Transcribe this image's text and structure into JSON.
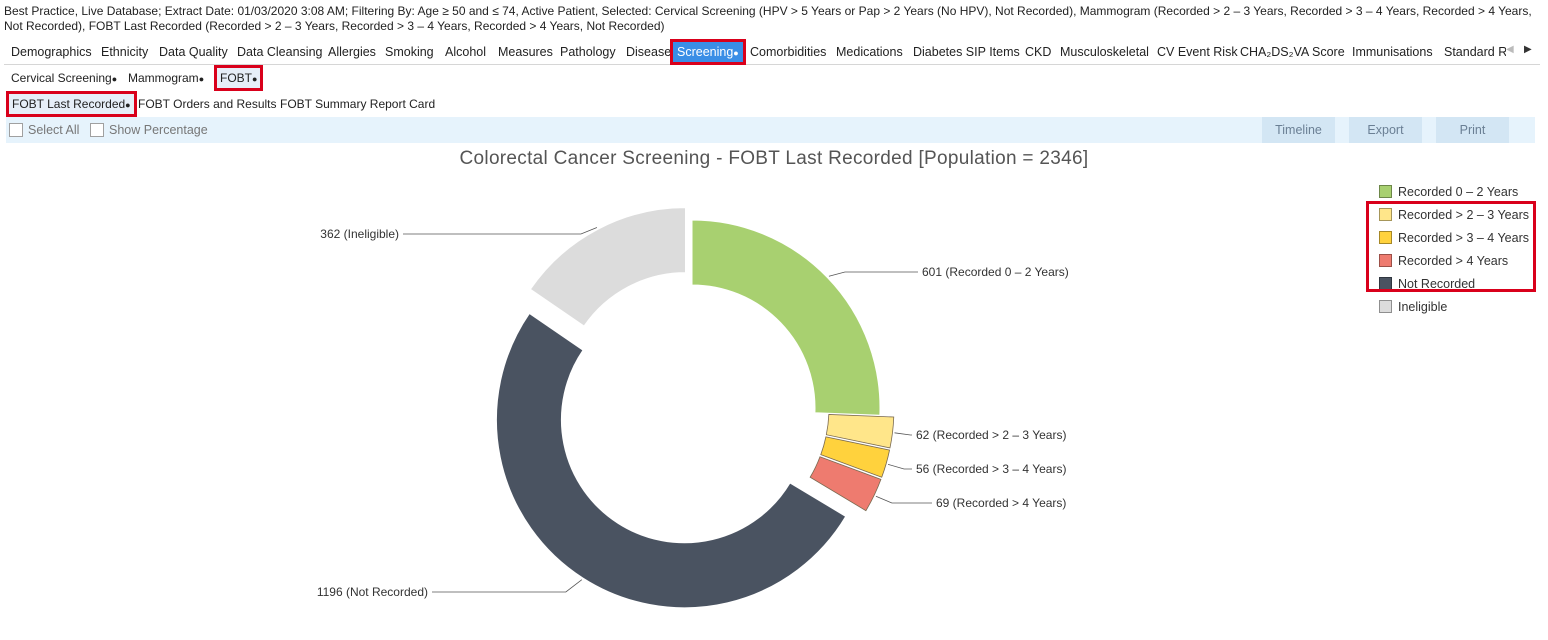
{
  "header": {
    "text": "Best Practice, Live Database; Extract Date: 01/03/2020 3:08 AM; Filtering By: Age ≥ 50 and ≤ 74, Active Patient, Selected: Cervical Screening (HPV > 5 Years or Pap > 2 Years (No HPV), Not Recorded), Mammogram (Recorded > 2 – 3 Years, Recorded > 3 – 4 Years, Recorded > 4 Years, Not Recorded), FOBT Last Recorded (Recorded > 2 – 3 Years, Recorded > 3 – 4 Years, Recorded > 4 Years, Not Recorded)"
  },
  "tabs": [
    {
      "label": "Demographics"
    },
    {
      "label": "Ethnicity"
    },
    {
      "label": "Data Quality"
    },
    {
      "label": "Data Cleansing"
    },
    {
      "label": "Allergies"
    },
    {
      "label": "Smoking"
    },
    {
      "label": "Alcohol"
    },
    {
      "label": "Measures"
    },
    {
      "label": "Pathology"
    },
    {
      "label": "Disease"
    },
    {
      "label": "Screening"
    },
    {
      "label": "Comorbidities"
    },
    {
      "label": "Medications"
    },
    {
      "label": "Diabetes SIP Items"
    },
    {
      "label": "CKD"
    },
    {
      "label": "Musculoskeletal"
    },
    {
      "label": "CV Event Risk"
    },
    {
      "label": "CHA₂DS₂VA Score"
    },
    {
      "label": "Immunisations"
    },
    {
      "label": "Standard R"
    }
  ],
  "active_dot": "●",
  "screening_tabs": [
    {
      "label": "Cervical Screening"
    },
    {
      "label": "Mammogram"
    },
    {
      "label": "FOBT"
    }
  ],
  "fobt_tabs": [
    {
      "label": "FOBT Last Recorded"
    },
    {
      "label": "FOBT Orders and Results"
    },
    {
      "label": "FOBT Summary Report Card"
    }
  ],
  "toolbar": {
    "select_all": "Select All",
    "show_percentage": "Show Percentage",
    "timeline": "Timeline",
    "export": "Export",
    "print": "Print"
  },
  "chart_data": {
    "type": "pie",
    "subtype": "donut",
    "title": "Colorectal Cancer Screening - FOBT Last Recorded [Population = 2346]",
    "legend_position": "top-right",
    "series": [
      {
        "name": "Recorded 0 – 2 Years",
        "value": 601,
        "label": "601 (Recorded 0 – 2 Years)",
        "color": "#a8d070",
        "exploded": false
      },
      {
        "name": "Recorded > 2 – 3 Years",
        "value": 62,
        "label": "62 (Recorded > 2 – 3 Years)",
        "color": "#ffe68a",
        "exploded": true
      },
      {
        "name": "Recorded > 3 – 4 Years",
        "value": 56,
        "label": "56 (Recorded > 3 – 4 Years)",
        "color": "#ffd23d",
        "exploded": true
      },
      {
        "name": "Recorded > 4 Years",
        "value": 69,
        "label": "69 (Recorded > 4 Years)",
        "color": "#ee7b6f",
        "exploded": true
      },
      {
        "name": "Not Recorded",
        "value": 1196,
        "label": "1196 (Not Recorded)",
        "color": "#4a5361",
        "exploded": true
      },
      {
        "name": "Ineligible",
        "value": 362,
        "label": "362 (Ineligible)",
        "color": "#dcdcdc",
        "exploded": true
      }
    ]
  }
}
